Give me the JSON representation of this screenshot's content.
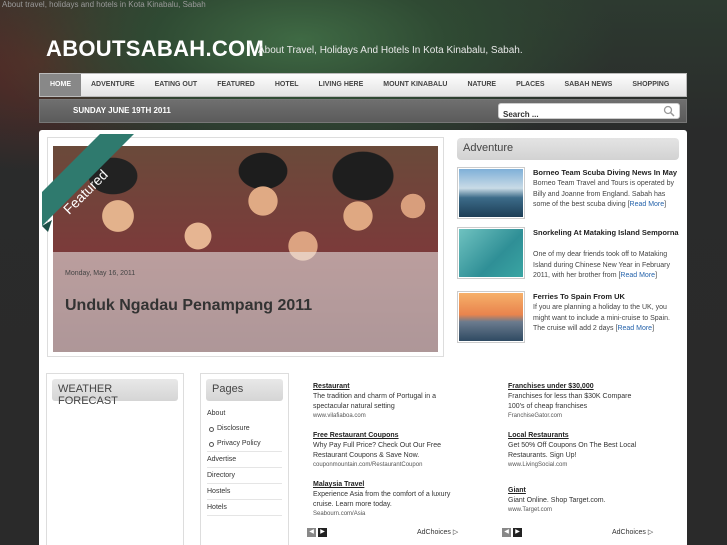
{
  "window_title": "About travel, holidays and hotels in Kota Kinabalu, Sabah",
  "site": {
    "logo": "ABOUTSABAH.COM",
    "tagline": "About Travel, Holidays And Hotels In Kota Kinabalu, Sabah."
  },
  "nav": [
    "HOME",
    "ADVENTURE",
    "EATING OUT",
    "FEATURED",
    "HOTEL",
    "LIVING HERE",
    "MOUNT KINABALU",
    "NATURE",
    "PLACES",
    "SABAH NEWS",
    "SHOPPING"
  ],
  "date": "SUNDAY JUNE 19TH 2011",
  "search": {
    "value": "Search ..."
  },
  "featured": {
    "ribbon": "Featured",
    "date": "Monday, May 16, 2011",
    "title": "Unduk Ngadau Penampang 2011"
  },
  "adventure": {
    "heading": "Adventure",
    "read_more": "Read More",
    "posts": [
      {
        "title": "Borneo Team Scuba Diving News In May",
        "excerpt": "Borneo Team Travel and Tours is operated by Billy and Joanne from England. Sabah has some of the best scuba diving"
      },
      {
        "title": "Snorkeling At Mataking Island Semporna",
        "excerpt": "One of my dear friends took off to Mataking Island during Chinese New Year in February 2011, with her brother from"
      },
      {
        "title": "Ferries To Spain From UK",
        "excerpt": "If you are planning a holiday to the UK, you might want to include a mini-cruise to Spain. The cruise will add 2 days"
      }
    ]
  },
  "weather": {
    "heading": "WEATHER FORECAST"
  },
  "pages": {
    "heading": "Pages",
    "items": [
      "About",
      "Disclosure",
      "Privacy Policy",
      "Advertise",
      "Directory",
      "Hostels",
      "Hotels"
    ]
  },
  "ads": [
    {
      "title": "Restaurant",
      "body": "The tradition and charm of Portugal in a spectacular natural setting",
      "url": "www.vilafiaboa.com"
    },
    {
      "title": "Free Restaurant Coupons",
      "body": "Why Pay Full Price? Check Out Our Free Restaurant Coupons & Save Now.",
      "url": "couponmountain.com/RestaurantCoupon"
    },
    {
      "title": "Malaysia Travel",
      "body": "Experience Asia from the comfort of a luxury cruise. Learn more today.",
      "url": "Seabourn.com/Asia"
    },
    {
      "title": "Franchises under $30,000",
      "body": "Franchises for less than $30K Compare 100's of cheap franchises",
      "url": "FranchiseGator.com"
    },
    {
      "title": "Local Restaurants",
      "body": "Get 50% Off Coupons On The Best Local Restaurants. Sign Up!",
      "url": "www.LivingSocial.com"
    },
    {
      "title": "Giant",
      "body": "Giant Online. Shop Target.com.",
      "url": "www.Target.com"
    }
  ],
  "adchoices": "AdChoices",
  "colors": {
    "accent_teal": "#2f7a6e",
    "link": "#2563ab"
  }
}
